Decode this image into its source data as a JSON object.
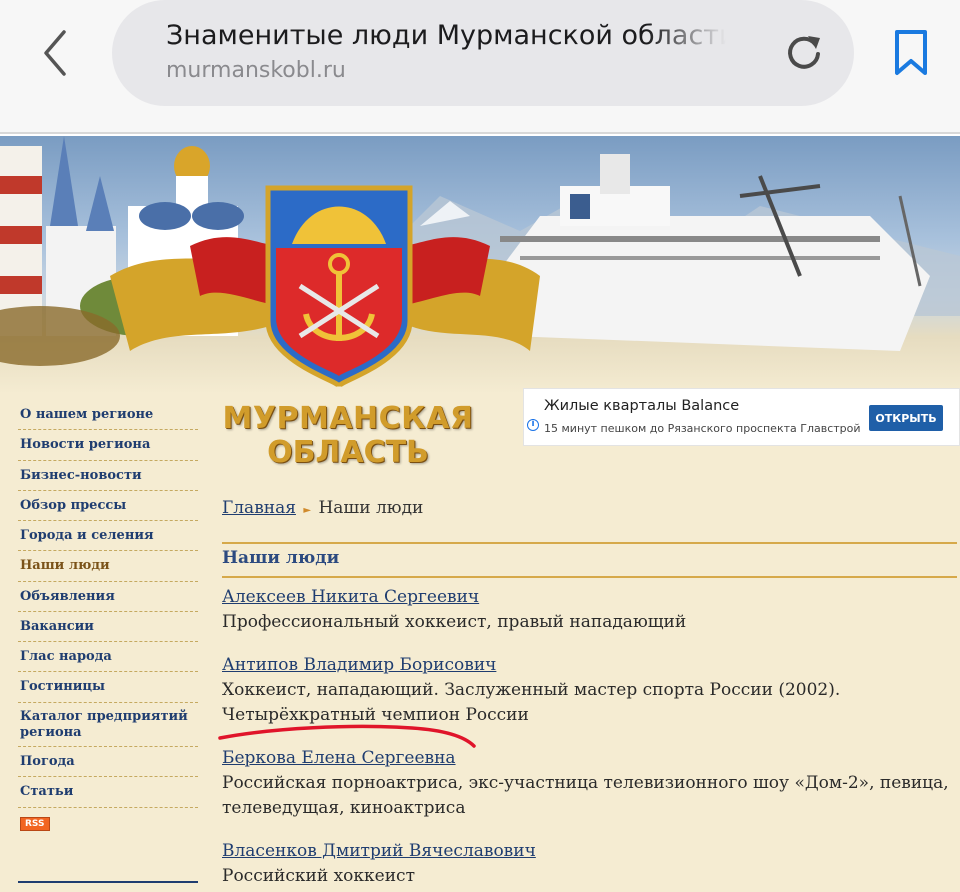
{
  "browser": {
    "page_title": "Знаменитые люди Мурманской области",
    "domain": "murmanskobl.ru"
  },
  "logo": {
    "line1": "МУРМАНСКАЯ",
    "line2": "ОБЛАСТЬ"
  },
  "ad": {
    "title": "Жилые кварталы Balance",
    "subtitle": "15 минут пешком до Рязанского проспекта Главстрой",
    "button": "ОТКРЫТЬ",
    "info_icon": "i"
  },
  "sidebar": {
    "items": [
      {
        "label": "О нашем регионе"
      },
      {
        "label": "Новости региона"
      },
      {
        "label": "Бизнес-новости"
      },
      {
        "label": "Обзор прессы"
      },
      {
        "label": "Города и селения"
      },
      {
        "label": "Наши люди",
        "active": true
      },
      {
        "label": "Объявления"
      },
      {
        "label": "Вакансии"
      },
      {
        "label": "Глас народа"
      },
      {
        "label": "Гостиницы"
      },
      {
        "label": "Каталог предприятий региона"
      },
      {
        "label": "Погода"
      },
      {
        "label": "Статьи"
      }
    ],
    "rss_label": "RSS"
  },
  "breadcrumb": {
    "home": "Главная",
    "current": "Наши люди",
    "separator": "►"
  },
  "section": {
    "title": "Наши люди"
  },
  "people": [
    {
      "name": "Алексеев Никита Сергеевич",
      "desc": "Профессиональный хоккеист, правый нападающий"
    },
    {
      "name": "Антипов Владимир Борисович",
      "desc": "Хоккеист, нападающий. Заслуженный мастер спорта России (2002). Четырёхкратный чемпион России"
    },
    {
      "name": "Беркова Елена Сергеевна",
      "desc": "Российская порноактриса, экс-участница телевизионного шоу «Дом-2», певица, телеведущая, киноактриса"
    },
    {
      "name": "Власенков Дмитрий Вячеславович",
      "desc": "Российский хоккеист"
    }
  ],
  "colors": {
    "link": "#1f3d70",
    "accent_gold": "#d6a94a",
    "page_bg": "#f5ecd2",
    "ad_button": "#1f5fa8",
    "highlight_red": "#e0142a"
  }
}
